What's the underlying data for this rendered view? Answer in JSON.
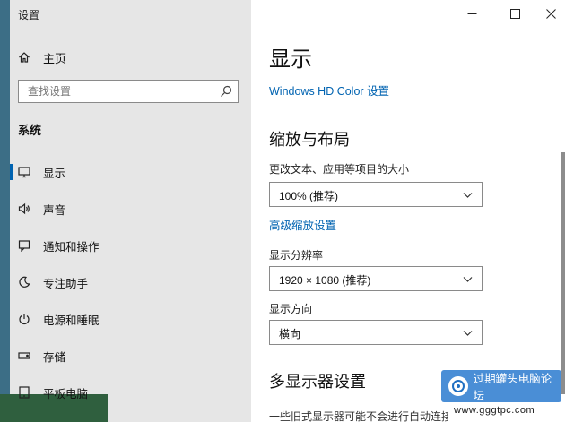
{
  "window": {
    "title": "设置"
  },
  "sidebar": {
    "home_label": "主页",
    "search_placeholder": "查找设置",
    "section_title": "系统",
    "items": [
      {
        "label": "显示",
        "icon": "monitor-icon",
        "active": true
      },
      {
        "label": "声音",
        "icon": "speaker-icon",
        "active": false
      },
      {
        "label": "通知和操作",
        "icon": "notification-icon",
        "active": false
      },
      {
        "label": "专注助手",
        "icon": "moon-icon",
        "active": false
      },
      {
        "label": "电源和睡眠",
        "icon": "power-icon",
        "active": false
      },
      {
        "label": "存储",
        "icon": "storage-icon",
        "active": false
      },
      {
        "label": "平板电脑",
        "icon": "tablet-icon",
        "active": false
      }
    ]
  },
  "main": {
    "page_title": "显示",
    "hdr_link": "Windows HD Color 设置",
    "scale_heading": "缩放与布局",
    "scale_label": "更改文本、应用等项目的大小",
    "scale_value": "100% (推荐)",
    "advanced_scale_link": "高级缩放设置",
    "resolution_label": "显示分辨率",
    "resolution_value": "1920 × 1080 (推荐)",
    "orientation_label": "显示方向",
    "orientation_value": "横向",
    "multi_heading": "多显示器设置",
    "partial_text": "一些旧式显示器可能不会进行自动连接"
  },
  "watermark": {
    "text": "过期罐头电脑论坛",
    "url": "www.gggtpc.com"
  },
  "colors": {
    "accent": "#0063b1",
    "sidebar_bg": "#e6e6e6",
    "content_bg": "#ffffff"
  }
}
